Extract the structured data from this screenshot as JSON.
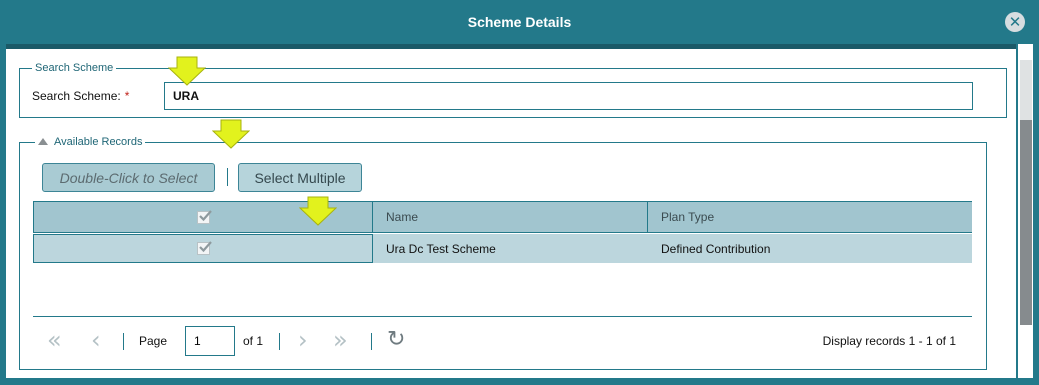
{
  "dialog": {
    "title": "Scheme Details",
    "close_icon": "close-circle-icon"
  },
  "search": {
    "legend": "Search Scheme",
    "label": "Search Scheme:",
    "required_marker": "*",
    "value": "URA"
  },
  "records": {
    "legend": "Available Records",
    "collapse_icon": "triangle-up-icon",
    "buttons": {
      "double_click": "Double-Click to Select",
      "select_multiple": "Select Multiple"
    },
    "columns": [
      "",
      "Name",
      "Plan Type"
    ],
    "rows": [
      {
        "checked": true,
        "name": "Ura Dc Test Scheme",
        "plan_type": "Defined Contribution"
      }
    ]
  },
  "pager": {
    "first_icon": "double-chevron-left-icon",
    "prev_icon": "chevron-left-icon",
    "page_label": "Page",
    "page_value": "1",
    "of_label": "of 1",
    "next_icon": "chevron-right-icon",
    "last_icon": "double-chevron-right-icon",
    "refresh_icon": "refresh-icon",
    "display_text": "Display records 1 - 1 of 1"
  },
  "annotations": {
    "arrow_color": "#e2f21d",
    "count": 4
  },
  "colors": {
    "header_bg": "#23798a",
    "grid_header_bg": "#a1c5cf",
    "grid_row_bg": "#bcd6dd"
  }
}
